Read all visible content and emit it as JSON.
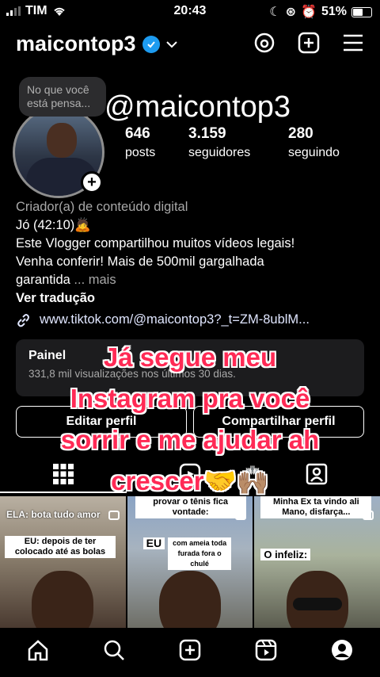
{
  "status": {
    "carrier": "TIM",
    "time": "20:43",
    "battery": "51%"
  },
  "header": {
    "username": "maicontop3",
    "verified": true
  },
  "note": {
    "placeholder": "No que você está pensa..."
  },
  "overlay_handle": "@maicontop3",
  "stats": [
    {
      "value": "646",
      "label": "posts"
    },
    {
      "value": "3.159",
      "label": "seguidores"
    },
    {
      "value": "280",
      "label": "seguindo"
    }
  ],
  "bio": {
    "category": "Criador(a) de conteúdo digital",
    "line1": "Jó (42:10)🙇",
    "line2": "Este Vlogger compartilhou muitos vídeos legais!",
    "line3": "Venha conferir!   Mais de 500mil gargalhada",
    "line4": "garantida",
    "more": " ... mais",
    "translate": "Ver tradução",
    "link": "www.tiktok.com/@maicontop3?_t=ZM-8ublM..."
  },
  "dashboard": {
    "title": "Painel",
    "subtitle": "331,8 mil visualizações nos últimos 30 dias."
  },
  "buttons": {
    "edit": "Editar perfil",
    "share": "Compartilhar perfil"
  },
  "caption": {
    "line1": "Já segue meu",
    "line2": "Instagram pra você",
    "line3": "sorrir e me ajudar ah",
    "line4": "crescer🤝🙌🏽"
  },
  "posts": [
    {
      "top_text": "ELA: bota tudo amor",
      "tag": "EU: depois de ter colocado até as bolas"
    },
    {
      "top_text": "provar o tênis fica vontade:",
      "tag_bold": "EU",
      "tag": "com ameia toda furada fora o chulé"
    },
    {
      "top_text": "Minha Ex ta vindo ali Mano, disfarça...",
      "tag": "O infeliz:"
    }
  ],
  "icons": {
    "threads": "threads-icon",
    "create": "plus-square-icon",
    "menu": "hamburger-menu-icon",
    "grid": "grid-icon",
    "reels": "reels-icon",
    "tagged": "tagged-user-icon",
    "home": "home-icon",
    "search": "search-icon",
    "add": "add-post-icon",
    "profile": "profile-icon"
  }
}
